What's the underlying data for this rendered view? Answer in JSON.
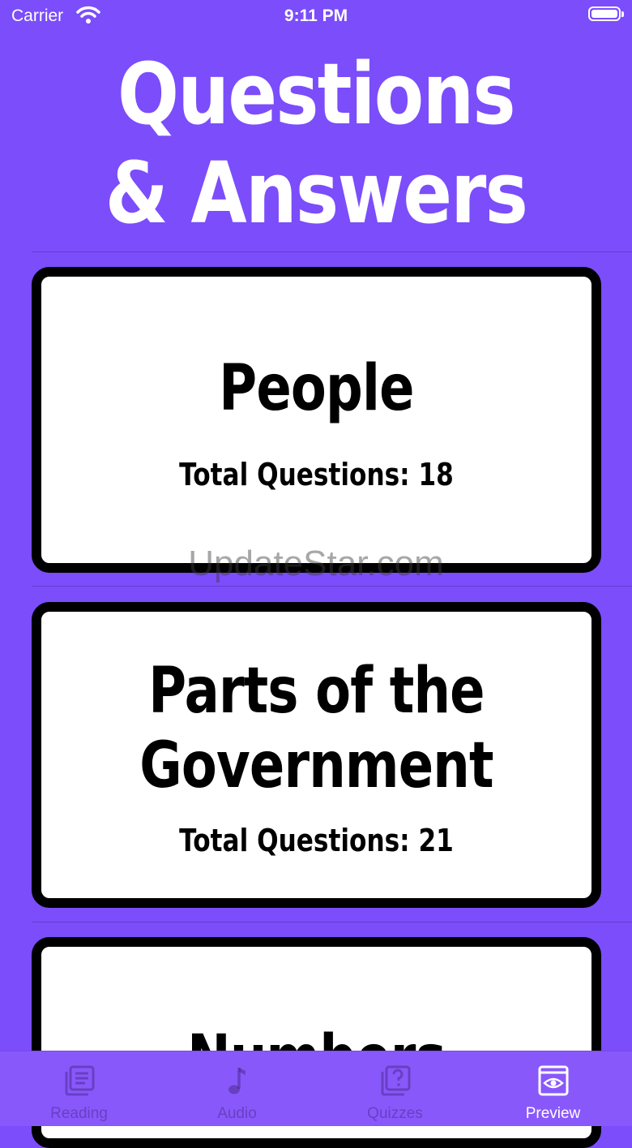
{
  "status_bar": {
    "carrier": "Carrier",
    "time": "9:11 PM"
  },
  "header": {
    "title_line1": "Questions",
    "title_line2": "& Answers"
  },
  "cards": [
    {
      "title": "People",
      "count": "Total Questions: 18"
    },
    {
      "title_line1": "Parts of the",
      "title_line2": "Government",
      "count": "Total Questions: 21"
    },
    {
      "title": "Numbers"
    }
  ],
  "watermark": "UpdateStar.com",
  "tab_bar": {
    "items": [
      {
        "label": "Reading",
        "icon": "reading-icon",
        "active": false
      },
      {
        "label": "Audio",
        "icon": "music-note-icon",
        "active": false
      },
      {
        "label": "Quizzes",
        "icon": "quiz-icon",
        "active": false
      },
      {
        "label": "Preview",
        "icon": "eye-icon",
        "active": true
      }
    ]
  },
  "colors": {
    "background": "#7b4dfb",
    "tab_bar": "#8958fb",
    "card": "#ffffff",
    "card_border": "#000000"
  }
}
